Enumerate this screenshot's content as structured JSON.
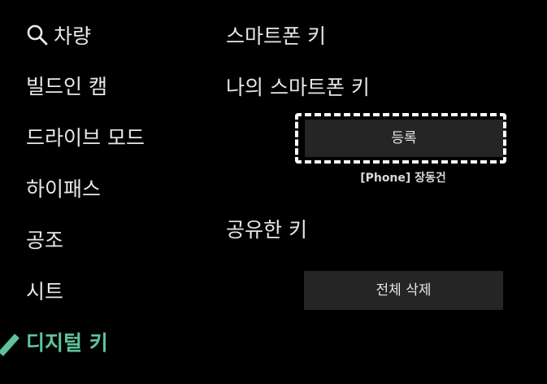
{
  "sidebar": {
    "items": [
      {
        "label": "차량",
        "icon": "search-icon"
      },
      {
        "label": "빌드인 캠"
      },
      {
        "label": "드라이브 모드"
      },
      {
        "label": "하이패스"
      },
      {
        "label": "공조"
      },
      {
        "label": "시트"
      },
      {
        "label": "디지털 키",
        "active": true
      }
    ],
    "active_color": "#5fc29b"
  },
  "main": {
    "smartphone_key_title": "스마트폰 키",
    "my_smartphone_key_title": "나의 스마트폰 키",
    "register_button_label": "등록",
    "phone_caption": "[Phone] 장동건",
    "shared_key_title": "공유한 키",
    "delete_all_button_label": "전체 삭제"
  }
}
